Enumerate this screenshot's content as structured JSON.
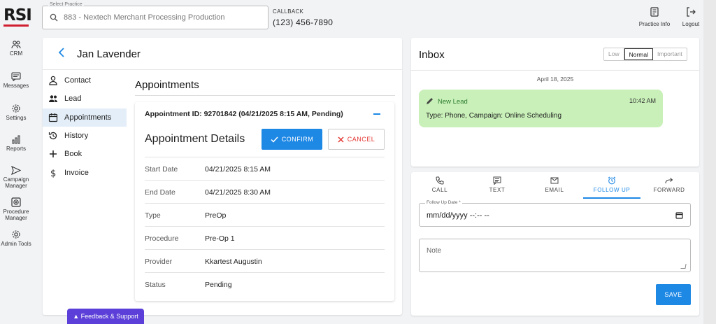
{
  "brand": {
    "logo_text": "RSI",
    "accent": "#d02030"
  },
  "sidebar": {
    "items": [
      {
        "label": "CRM",
        "icon": "users-icon"
      },
      {
        "label": "Messages",
        "icon": "message-icon"
      },
      {
        "label": "Settings",
        "icon": "gear-icon"
      },
      {
        "label": "Reports",
        "icon": "bar-chart-icon"
      },
      {
        "label": "Campaign Manager",
        "icon": "send-icon"
      },
      {
        "label": "Procedure Manager",
        "icon": "plus-box-icon"
      },
      {
        "label": "Admin Tools",
        "icon": "gear-icon"
      }
    ]
  },
  "header": {
    "practice_label": "Select Practice",
    "practice_value": "883 - Nextech Merchant Processing Production",
    "callback_label": "CALLBACK",
    "callback_phone": "(123) 456-7890",
    "practice_info_label": "Practice Info",
    "logout_label": "Logout"
  },
  "patient": {
    "name": "Jan Lavender",
    "menu": [
      {
        "label": "Contact",
        "icon": "person-icon"
      },
      {
        "label": "Lead",
        "icon": "people-icon"
      },
      {
        "label": "Appointments",
        "icon": "calendar-icon",
        "active": true
      },
      {
        "label": "History",
        "icon": "history-icon"
      },
      {
        "label": "Book",
        "icon": "plus-icon"
      },
      {
        "label": "Invoice",
        "icon": "dollar-icon"
      }
    ],
    "section_title": "Appointments",
    "appointment": {
      "id_line": "Appointment ID: 92701842 (04/21/2025 8:15 AM, Pending)",
      "details_title": "Appointment Details",
      "confirm_label": "CONFIRM",
      "cancel_label": "CANCEL",
      "rows": [
        {
          "label": "Start Date",
          "value": "04/21/2025 8:15 AM"
        },
        {
          "label": "End Date",
          "value": "04/21/2025 8:30 AM"
        },
        {
          "label": "Type",
          "value": "PreOp"
        },
        {
          "label": "Procedure",
          "value": "Pre-Op 1"
        },
        {
          "label": "Provider",
          "value": "Kkartest Augustin"
        },
        {
          "label": "Status",
          "value": "Pending"
        }
      ]
    }
  },
  "feedback_label": "▲ Feedback & Support",
  "inbox": {
    "title": "Inbox",
    "priority": [
      {
        "label": "Low"
      },
      {
        "label": "Normal",
        "active": true
      },
      {
        "label": "Important"
      }
    ],
    "date": "April 18, 2025",
    "message": {
      "title": "New Lead",
      "time": "10:42 AM",
      "body": "Type: Phone, Campaign: Online Scheduling",
      "bg_color": "#c8f0b8"
    }
  },
  "actions": {
    "tabs": [
      {
        "label": "CALL",
        "icon": "phone-icon"
      },
      {
        "label": "TEXT",
        "icon": "text-message-icon"
      },
      {
        "label": "EMAIL",
        "icon": "mail-icon"
      },
      {
        "label": "FOLLOW UP",
        "icon": "alarm-icon",
        "active": true
      },
      {
        "label": "FORWARD",
        "icon": "forward-icon"
      }
    ],
    "follow_up_label": "Follow Up Date *",
    "follow_up_value": "mm/dd/yyyy --:-- --",
    "note_placeholder": "Note",
    "save_label": "SAVE"
  },
  "colors": {
    "primary": "#1e88e5",
    "danger": "#e53935",
    "feedback": "#5b3fd8"
  }
}
